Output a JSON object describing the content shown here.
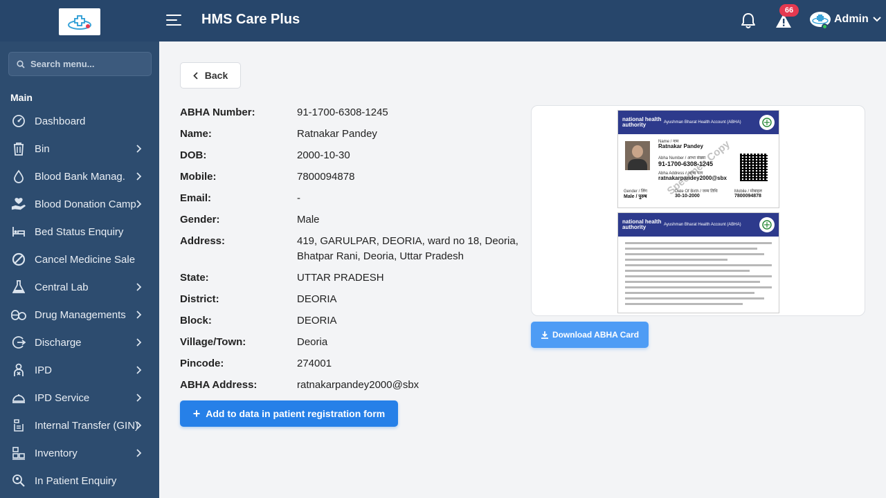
{
  "app": {
    "title": "HMS Care Plus",
    "alert_count": "66",
    "user_name": "Admin"
  },
  "sidebar": {
    "search_placeholder": "Search menu...",
    "section": "Main",
    "items": [
      {
        "label": "Dashboard",
        "icon": "dashboard-icon",
        "has_children": false
      },
      {
        "label": "Bin",
        "icon": "bin-icon",
        "has_children": true
      },
      {
        "label": "Blood Bank Manag.",
        "icon": "blood-drop-icon",
        "has_children": true
      },
      {
        "label": "Blood Donation Camp",
        "icon": "donation-hand-icon",
        "has_children": true
      },
      {
        "label": "Bed Status Enquiry",
        "icon": "bed-icon",
        "has_children": false
      },
      {
        "label": "Cancel Medicine Sale",
        "icon": "cancel-icon",
        "has_children": false
      },
      {
        "label": "Central Lab",
        "icon": "flask-icon",
        "has_children": true
      },
      {
        "label": "Drug Managements",
        "icon": "drug-icon",
        "has_children": true
      },
      {
        "label": "Discharge",
        "icon": "discharge-icon",
        "has_children": true
      },
      {
        "label": "IPD",
        "icon": "patient-icon",
        "has_children": true
      },
      {
        "label": "IPD Service",
        "icon": "service-icon",
        "has_children": true
      },
      {
        "label": "Internal Transfer (GIN)",
        "icon": "transfer-icon",
        "has_children": true
      },
      {
        "label": "Inventory",
        "icon": "inventory-icon",
        "has_children": true
      },
      {
        "label": "In Patient Enquiry",
        "icon": "enquiry-icon",
        "has_children": false
      }
    ]
  },
  "main": {
    "back_label": "Back",
    "details": [
      {
        "key": "ABHA Number:",
        "value": "91-1700-6308-1245"
      },
      {
        "key": "Name:",
        "value": "Ratnakar Pandey"
      },
      {
        "key": "DOB:",
        "value": "2000-10-30"
      },
      {
        "key": "Mobile:",
        "value": "7800094878"
      },
      {
        "key": "Email:",
        "value": "-"
      },
      {
        "key": "Gender:",
        "value": "Male"
      },
      {
        "key": "Address:",
        "value": "419, GARULPAR, DEORIA, ward no 18, Deoria, Bhatpar Rani, Deoria, Uttar Pradesh"
      },
      {
        "key": "State:",
        "value": "UTTAR PRADESH"
      },
      {
        "key": "District:",
        "value": "DEORIA"
      },
      {
        "key": "Block:",
        "value": "DEORIA"
      },
      {
        "key": "Village/Town:",
        "value": "Deoria"
      },
      {
        "key": "Pincode:",
        "value": "274001"
      },
      {
        "key": "ABHA Address:",
        "value": "ratnakarpandey2000@sbx"
      }
    ],
    "add_button": "Add to data in patient registration form",
    "download_button": "Download ABHA Card",
    "card": {
      "org": "national health authority",
      "header": "Ayushman Bharat Health Account (ABHA)",
      "name_label": "Name / नाम",
      "name": "Ratnakar Pandey",
      "abha_label": "Abha Number / आभा संख्या",
      "abha_number": "91-1700-6308-1245",
      "address_label": "Abha Address / आभा पता",
      "abha_address": "ratnakarpandey2000@sbx",
      "gender_label": "Gender / लिंग",
      "gender": "Male / पुरुष",
      "dob_label": "Date Of Birth / जन्म तिथि",
      "dob": "30-10-2000",
      "mobile_label": "Mobile / मोबाइल",
      "mobile": "7800094878",
      "watermark": "Specimen Copy"
    }
  }
}
